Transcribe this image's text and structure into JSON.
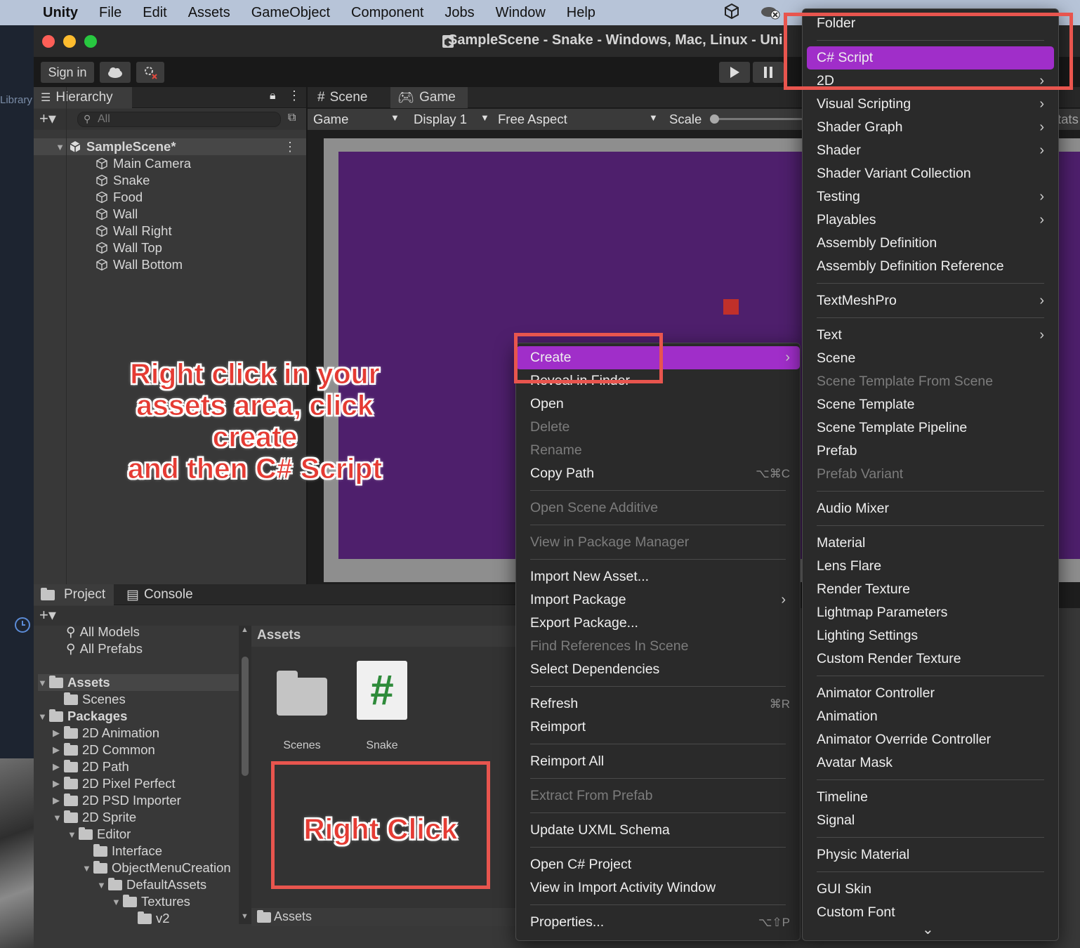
{
  "menubar": {
    "app": "Unity",
    "items": [
      "File",
      "Edit",
      "Assets",
      "GameObject",
      "Component",
      "Jobs",
      "Window",
      "Help"
    ]
  },
  "window": {
    "title": "SampleScene - Snake - Windows, Mac, Linux - Uni"
  },
  "toolbar": {
    "sign_in": "Sign in"
  },
  "side_label": "Library",
  "hierarchy": {
    "tab": "Hierarchy",
    "search_placeholder": "All",
    "scene": "SampleScene*",
    "objects": [
      "Main Camera",
      "Snake",
      "Food",
      "Wall",
      "Wall Right",
      "Wall Top",
      "Wall Bottom"
    ]
  },
  "game_tabs": {
    "scene": "Scene",
    "game": "Game"
  },
  "game_bar": {
    "mode": "Game",
    "display": "Display 1",
    "aspect": "Free Aspect",
    "scale": "Scale",
    "stats_partial": "tats"
  },
  "project": {
    "tabs": [
      "Project",
      "Console"
    ],
    "favorites": [
      "All Models",
      "All Prefabs"
    ],
    "tree": [
      {
        "label": "Assets",
        "depth": 0,
        "open": true,
        "bold": true
      },
      {
        "label": "Scenes",
        "depth": 1,
        "open": null,
        "bold": false
      },
      {
        "label": "Packages",
        "depth": 0,
        "open": true,
        "bold": true
      },
      {
        "label": "2D Animation",
        "depth": 1,
        "open": false,
        "bold": false
      },
      {
        "label": "2D Common",
        "depth": 1,
        "open": false,
        "bold": false
      },
      {
        "label": "2D Path",
        "depth": 1,
        "open": false,
        "bold": false
      },
      {
        "label": "2D Pixel Perfect",
        "depth": 1,
        "open": false,
        "bold": false
      },
      {
        "label": "2D PSD Importer",
        "depth": 1,
        "open": false,
        "bold": false
      },
      {
        "label": "2D Sprite",
        "depth": 1,
        "open": true,
        "bold": false
      },
      {
        "label": "Editor",
        "depth": 2,
        "open": true,
        "bold": false
      },
      {
        "label": "Interface",
        "depth": 3,
        "open": null,
        "bold": false
      },
      {
        "label": "ObjectMenuCreation",
        "depth": 3,
        "open": true,
        "bold": false
      },
      {
        "label": "DefaultAssets",
        "depth": 4,
        "open": true,
        "bold": false
      },
      {
        "label": "Textures",
        "depth": 5,
        "open": true,
        "bold": false
      },
      {
        "label": "v2",
        "depth": 6,
        "open": null,
        "bold": false
      }
    ],
    "breadcrumb": "Assets",
    "assets": [
      {
        "label": "Scenes",
        "icon": "folder-icon"
      },
      {
        "label": "Snake",
        "icon": "csharp-script-icon"
      }
    ],
    "footer_path": "Assets"
  },
  "context_menu": [
    {
      "label": "Create",
      "sub": true,
      "highlight": true
    },
    {
      "label": "Reveal in Finder"
    },
    {
      "label": "Open"
    },
    {
      "label": "Delete",
      "disabled": true
    },
    {
      "label": "Rename",
      "disabled": true
    },
    {
      "label": "Copy Path",
      "shortcut": "⌥⌘C"
    },
    {
      "sep": true
    },
    {
      "label": "Open Scene Additive",
      "disabled": true
    },
    {
      "sep": true
    },
    {
      "label": "View in Package Manager",
      "disabled": true
    },
    {
      "sep": true
    },
    {
      "label": "Import New Asset..."
    },
    {
      "label": "Import Package",
      "sub": true
    },
    {
      "label": "Export Package..."
    },
    {
      "label": "Find References In Scene",
      "disabled": true
    },
    {
      "label": "Select Dependencies"
    },
    {
      "sep": true
    },
    {
      "label": "Refresh",
      "shortcut": "⌘R"
    },
    {
      "label": "Reimport"
    },
    {
      "sep": true
    },
    {
      "label": "Reimport All"
    },
    {
      "sep": true
    },
    {
      "label": "Extract From Prefab",
      "disabled": true
    },
    {
      "sep": true
    },
    {
      "label": "Update UXML Schema"
    },
    {
      "sep": true
    },
    {
      "label": "Open C# Project"
    },
    {
      "label": "View in Import Activity Window"
    },
    {
      "sep": true
    },
    {
      "label": "Properties...",
      "shortcut": "⌥⇧P"
    }
  ],
  "create_menu": [
    {
      "label": "Folder"
    },
    {
      "sep": true
    },
    {
      "label": "C# Script",
      "highlight": true
    },
    {
      "label": "2D",
      "sub": true
    },
    {
      "label": "Visual Scripting",
      "sub": true
    },
    {
      "label": "Shader Graph",
      "sub": true
    },
    {
      "label": "Shader",
      "sub": true
    },
    {
      "label": "Shader Variant Collection"
    },
    {
      "label": "Testing",
      "sub": true
    },
    {
      "label": "Playables",
      "sub": true
    },
    {
      "label": "Assembly Definition"
    },
    {
      "label": "Assembly Definition Reference"
    },
    {
      "sep": true
    },
    {
      "label": "TextMeshPro",
      "sub": true
    },
    {
      "sep": true
    },
    {
      "label": "Text",
      "sub": true
    },
    {
      "label": "Scene"
    },
    {
      "label": "Scene Template From Scene",
      "disabled": true
    },
    {
      "label": "Scene Template"
    },
    {
      "label": "Scene Template Pipeline"
    },
    {
      "label": "Prefab"
    },
    {
      "label": "Prefab Variant",
      "disabled": true
    },
    {
      "sep": true
    },
    {
      "label": "Audio Mixer"
    },
    {
      "sep": true
    },
    {
      "label": "Material"
    },
    {
      "label": "Lens Flare"
    },
    {
      "label": "Render Texture"
    },
    {
      "label": "Lightmap Parameters"
    },
    {
      "label": "Lighting Settings"
    },
    {
      "label": "Custom Render Texture"
    },
    {
      "sep": true
    },
    {
      "label": "Animator Controller"
    },
    {
      "label": "Animation"
    },
    {
      "label": "Animator Override Controller"
    },
    {
      "label": "Avatar Mask"
    },
    {
      "sep": true
    },
    {
      "label": "Timeline"
    },
    {
      "label": "Signal"
    },
    {
      "sep": true
    },
    {
      "label": "Physic Material"
    },
    {
      "sep": true
    },
    {
      "label": "GUI Skin"
    },
    {
      "label": "Custom Font"
    }
  ],
  "annotations": {
    "instruction": "Right click in your assets area, click create and then C# Script",
    "right_click": "Right Click"
  },
  "colors": {
    "highlight": "#a02ec9",
    "annotation": "#e53b33",
    "game_bg": "#4e1f6c"
  }
}
